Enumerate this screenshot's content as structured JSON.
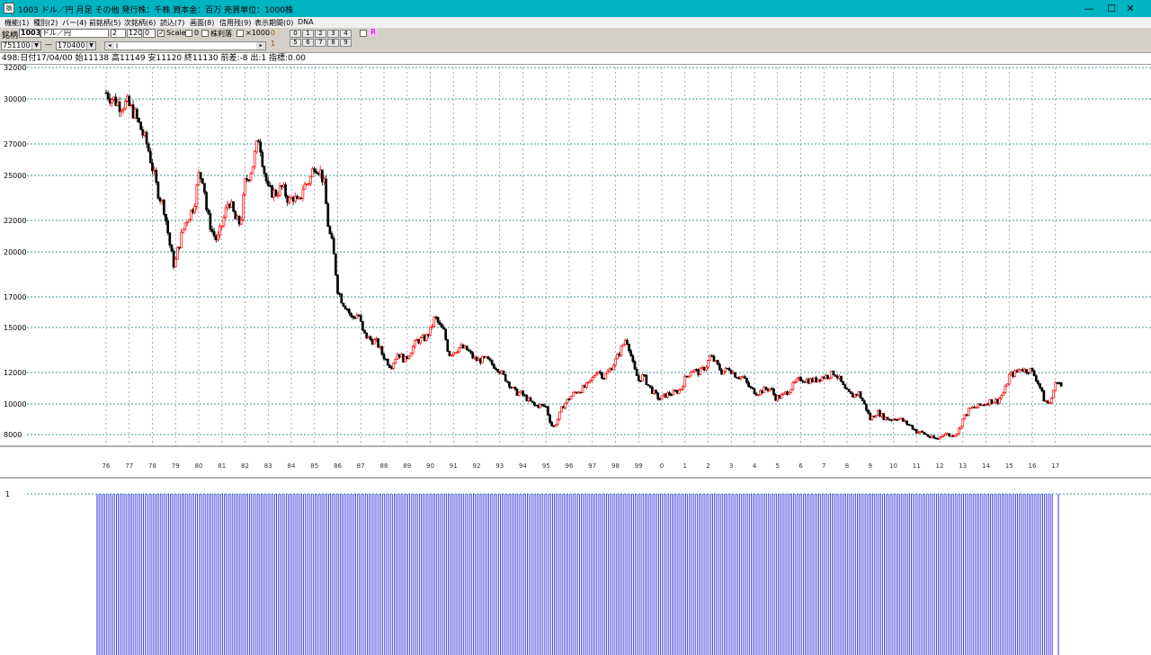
{
  "window": {
    "title": "1003 ドル／円 月足 その他 発行株：千株 資本金：百万 売買単位：1000株",
    "minimize": "—",
    "maximize": "☐",
    "close": "✕"
  },
  "menu": [
    "機能(1)",
    "種別(2)",
    "バー(4)",
    "前銘柄(5)",
    "次銘柄(6)",
    "読込(7)",
    "画面(8)",
    "信用残(9)",
    "表示期間(0)",
    "DNA"
  ],
  "toolbar": {
    "code_label": "銘柄",
    "code_value": "1003",
    "name_value": "ドル／円",
    "field1_value": "2",
    "field2_value": "1200",
    "field3_value": "0",
    "scale_label": "Scale",
    "scale_checked": true,
    "zero_label": "0",
    "price_ratio_label": "株利落",
    "x1000_label": "×1000",
    "side_top": "0",
    "side_bottom": "1",
    "num_buttons_top": [
      "0",
      "1",
      "2",
      "3",
      "4"
    ],
    "num_buttons_bottom": [
      "5",
      "6",
      "7",
      "8",
      "9"
    ],
    "r_label": "R",
    "start_value": "751100",
    "dash": "—",
    "end_value": "170400",
    "scroll_left": "◂",
    "scroll_right": "▸"
  },
  "info": {
    "text": "498:日付17/04/00 始11138 高11149 安11120 終11130 前差:-8 出:1 指標:0.00"
  },
  "chart_data": {
    "type": "candlestick",
    "y_axis_labels": [
      32000,
      30000,
      27000,
      25000,
      22000,
      20000,
      17000,
      15000,
      12000,
      10000,
      8000
    ],
    "x_axis_labels": [
      "76",
      "77",
      "78",
      "79",
      "80",
      "81",
      "82",
      "83",
      "84",
      "85",
      "86",
      "87",
      "88",
      "89",
      "90",
      "91",
      "92",
      "93",
      "94",
      "95",
      "96",
      "97",
      "98",
      "99",
      "0",
      "1",
      "2",
      "3",
      "4",
      "5",
      "6",
      "7",
      "8",
      "9",
      "10",
      "11",
      "12",
      "13",
      "14",
      "15",
      "16",
      "17"
    ],
    "ylim": [
      7200,
      32000
    ],
    "price_path": [
      [
        1976.0,
        30400
      ],
      [
        1976.3,
        30000
      ],
      [
        1976.6,
        29600
      ],
      [
        1976.9,
        29700
      ],
      [
        1977.2,
        29100
      ],
      [
        1977.5,
        28000
      ],
      [
        1977.8,
        26800
      ],
      [
        1978.0,
        25500
      ],
      [
        1978.2,
        24100
      ],
      [
        1978.5,
        22800
      ],
      [
        1978.8,
        20000
      ],
      [
        1978.95,
        19000
      ],
      [
        1979.1,
        20200
      ],
      [
        1979.4,
        21800
      ],
      [
        1979.8,
        23000
      ],
      [
        1980.0,
        25000
      ],
      [
        1980.2,
        24800
      ],
      [
        1980.35,
        22500
      ],
      [
        1980.6,
        21200
      ],
      [
        1980.8,
        20700
      ],
      [
        1981.0,
        21700
      ],
      [
        1981.3,
        23400
      ],
      [
        1981.6,
        22000
      ],
      [
        1981.8,
        21800
      ],
      [
        1982.0,
        24500
      ],
      [
        1982.3,
        25500
      ],
      [
        1982.6,
        27500
      ],
      [
        1982.8,
        25500
      ],
      [
        1983.0,
        24000
      ],
      [
        1983.3,
        23800
      ],
      [
        1983.6,
        24200
      ],
      [
        1983.9,
        23300
      ],
      [
        1984.1,
        23600
      ],
      [
        1984.3,
        23000
      ],
      [
        1984.5,
        24200
      ],
      [
        1984.8,
        24700
      ],
      [
        1985.0,
        25700
      ],
      [
        1985.2,
        25400
      ],
      [
        1985.4,
        24600
      ],
      [
        1985.6,
        21500
      ],
      [
        1985.8,
        20200
      ],
      [
        1986.0,
        17500
      ],
      [
        1986.2,
        16700
      ],
      [
        1986.4,
        16300
      ],
      [
        1986.6,
        15600
      ],
      [
        1986.9,
        15900
      ],
      [
        1987.1,
        14600
      ],
      [
        1987.4,
        14200
      ],
      [
        1987.7,
        14000
      ],
      [
        1987.9,
        13300
      ],
      [
        1988.1,
        12800
      ],
      [
        1988.3,
        12400
      ],
      [
        1988.6,
        13300
      ],
      [
        1988.9,
        12800
      ],
      [
        1989.1,
        13300
      ],
      [
        1989.4,
        14100
      ],
      [
        1989.8,
        14300
      ],
      [
        1990.0,
        14800
      ],
      [
        1990.2,
        15700
      ],
      [
        1990.4,
        15100
      ],
      [
        1990.6,
        14700
      ],
      [
        1990.8,
        13200
      ],
      [
        1991.0,
        13400
      ],
      [
        1991.3,
        13700
      ],
      [
        1991.6,
        13500
      ],
      [
        1991.9,
        12900
      ],
      [
        1992.1,
        12800
      ],
      [
        1992.4,
        12900
      ],
      [
        1992.7,
        12500
      ],
      [
        1992.9,
        12300
      ],
      [
        1993.1,
        11900
      ],
      [
        1993.4,
        11300
      ],
      [
        1993.7,
        10700
      ],
      [
        1993.9,
        10700
      ],
      [
        1994.2,
        10300
      ],
      [
        1994.5,
        9900
      ],
      [
        1994.8,
        9900
      ],
      [
        1995.0,
        9800
      ],
      [
        1995.15,
        9000
      ],
      [
        1995.3,
        8400
      ],
      [
        1995.5,
        9000
      ],
      [
        1995.7,
        9800
      ],
      [
        1995.9,
        10200
      ],
      [
        1996.2,
        10700
      ],
      [
        1996.5,
        10900
      ],
      [
        1996.8,
        11200
      ],
      [
        1997.0,
        11600
      ],
      [
        1997.2,
        12200
      ],
      [
        1997.5,
        11700
      ],
      [
        1997.8,
        12300
      ],
      [
        1998.0,
        12800
      ],
      [
        1998.25,
        13600
      ],
      [
        1998.45,
        14300
      ],
      [
        1998.6,
        13600
      ],
      [
        1998.8,
        12200
      ],
      [
        1999.0,
        11500
      ],
      [
        1999.2,
        11800
      ],
      [
        1999.4,
        11200
      ],
      [
        1999.6,
        10800
      ],
      [
        1999.9,
        10300
      ],
      [
        2000.2,
        10600
      ],
      [
        2000.5,
        10700
      ],
      [
        2000.8,
        10900
      ],
      [
        2001.0,
        11600
      ],
      [
        2001.3,
        12200
      ],
      [
        2001.6,
        12000
      ],
      [
        2001.9,
        12400
      ],
      [
        2002.1,
        13100
      ],
      [
        2002.3,
        12700
      ],
      [
        2002.6,
        12000
      ],
      [
        2002.9,
        12300
      ],
      [
        2003.2,
        11800
      ],
      [
        2003.5,
        11700
      ],
      [
        2003.8,
        11000
      ],
      [
        2004.1,
        10700
      ],
      [
        2004.4,
        10900
      ],
      [
        2004.7,
        11000
      ],
      [
        2004.9,
        10400
      ],
      [
        2005.2,
        10500
      ],
      [
        2005.5,
        10900
      ],
      [
        2005.8,
        11400
      ],
      [
        2006.0,
        11600
      ],
      [
        2006.3,
        11500
      ],
      [
        2006.6,
        11500
      ],
      [
        2006.9,
        11700
      ],
      [
        2007.2,
        11800
      ],
      [
        2007.45,
        12000
      ],
      [
        2007.7,
        11500
      ],
      [
        2007.9,
        10900
      ],
      [
        2008.2,
        10500
      ],
      [
        2008.5,
        10700
      ],
      [
        2008.8,
        9800
      ],
      [
        2009.0,
        9000
      ],
      [
        2009.3,
        9500
      ],
      [
        2009.6,
        9100
      ],
      [
        2009.9,
        9000
      ],
      [
        2010.2,
        9100
      ],
      [
        2010.5,
        8800
      ],
      [
        2010.8,
        8500
      ],
      [
        2011.0,
        8200
      ],
      [
        2011.3,
        8100
      ],
      [
        2011.6,
        7800
      ],
      [
        2011.9,
        7700
      ],
      [
        2012.2,
        8100
      ],
      [
        2012.5,
        7900
      ],
      [
        2012.8,
        8200
      ],
      [
        2013.0,
        9000
      ],
      [
        2013.3,
        9700
      ],
      [
        2013.6,
        9800
      ],
      [
        2013.9,
        10000
      ],
      [
        2014.2,
        10200
      ],
      [
        2014.5,
        10200
      ],
      [
        2014.8,
        10800
      ],
      [
        2015.0,
        11800
      ],
      [
        2015.3,
        12000
      ],
      [
        2015.5,
        12300
      ],
      [
        2015.7,
        12100
      ],
      [
        2015.9,
        12200
      ],
      [
        2016.1,
        11800
      ],
      [
        2016.3,
        11200
      ],
      [
        2016.5,
        10300
      ],
      [
        2016.7,
        10000
      ],
      [
        2016.85,
        10300
      ],
      [
        2016.95,
        11400
      ],
      [
        2017.1,
        11300
      ],
      [
        2017.25,
        11130
      ]
    ],
    "volume_axis_label": "1",
    "volume_bar_value": 1
  },
  "colors": {
    "titlebar": "#00b4c4",
    "toolbar": "#d4d0c8",
    "up_candle": "#ff0000",
    "down_candle": "#000000",
    "gridline": "#007878",
    "volume_bar": "#3030e0"
  }
}
